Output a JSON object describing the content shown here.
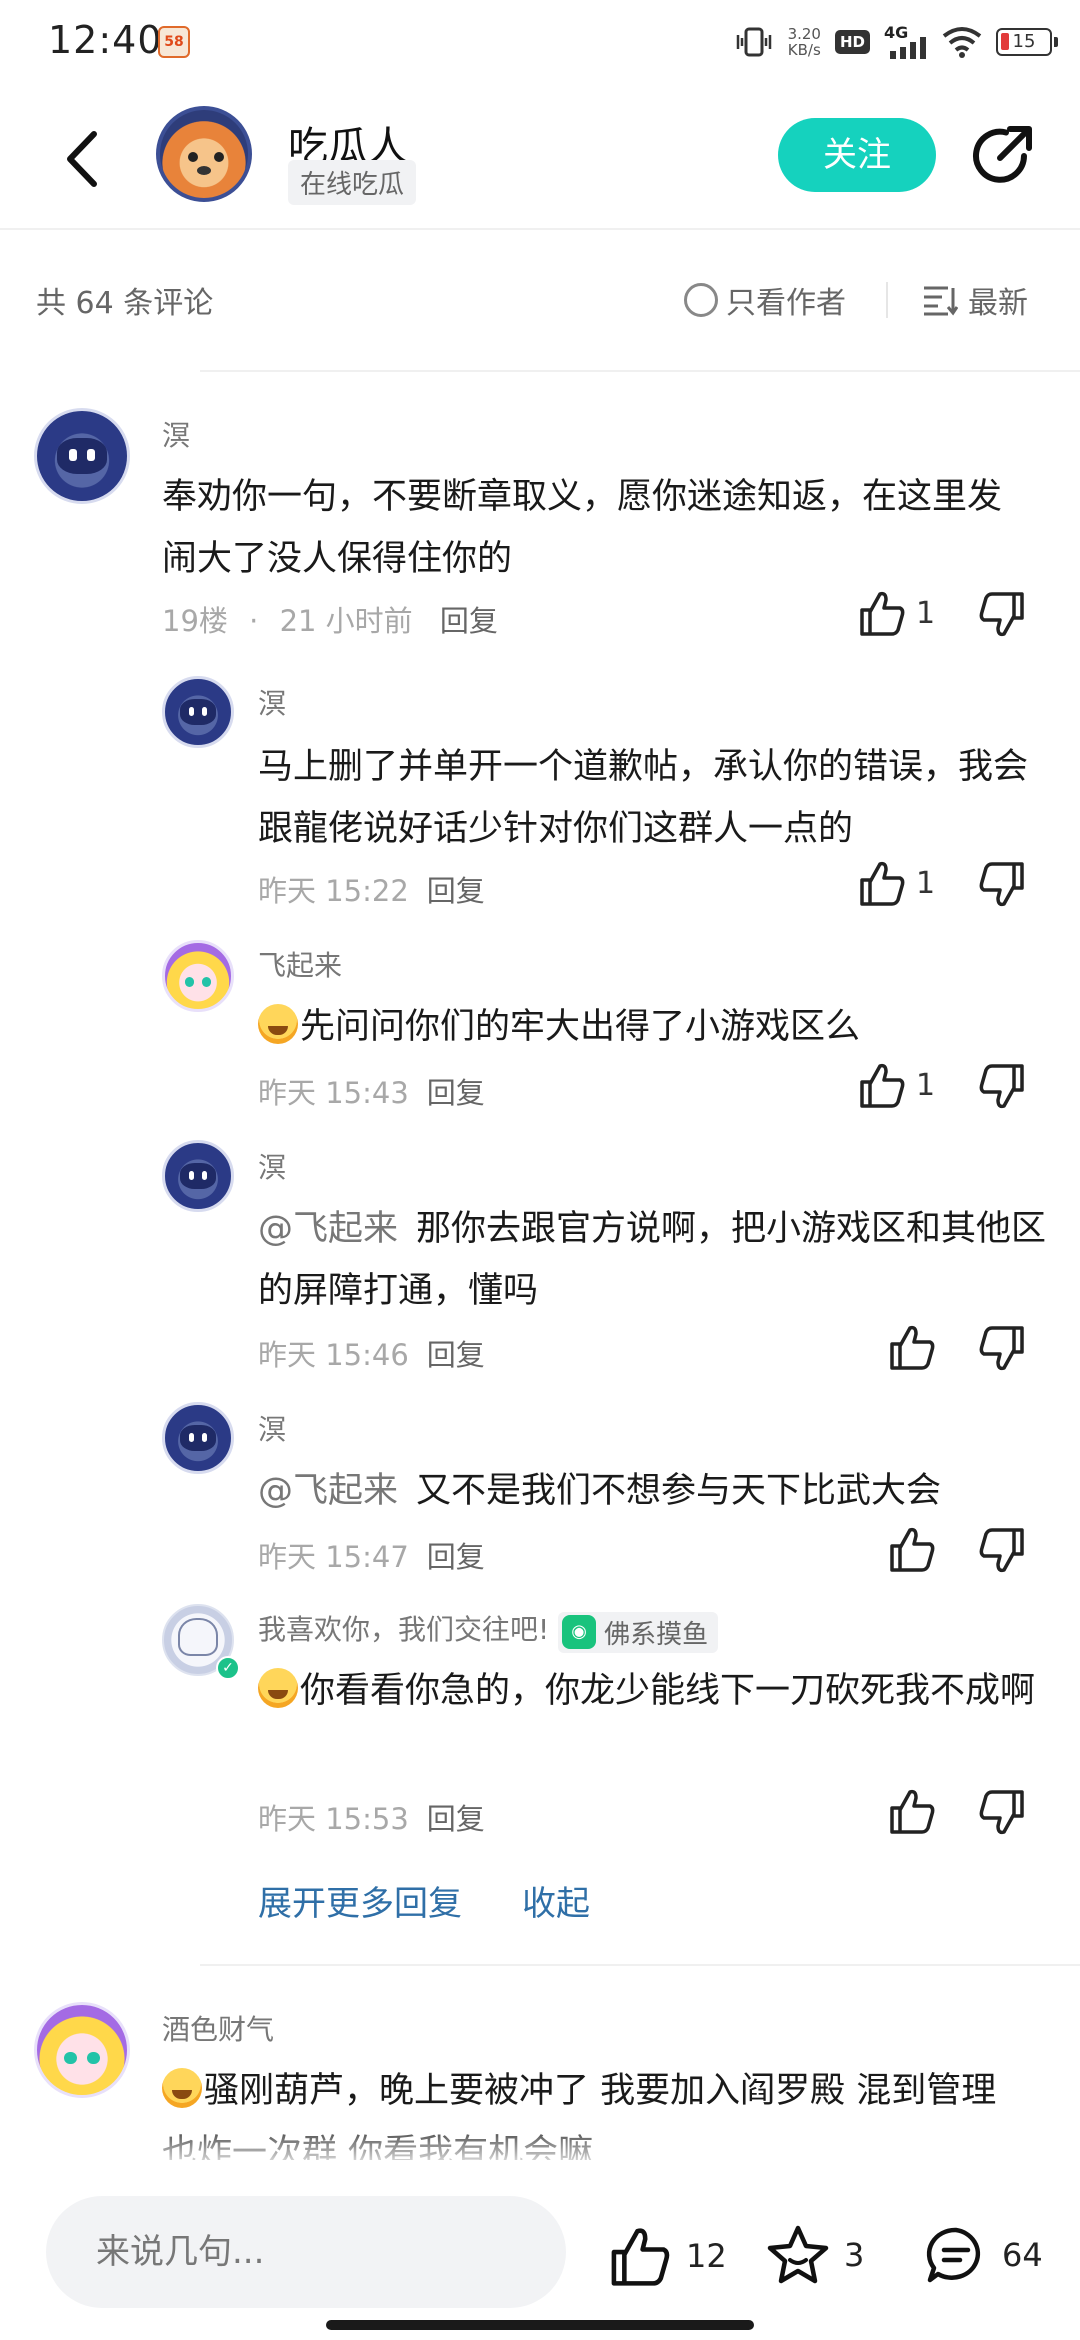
{
  "status_bar": {
    "time": "12:40",
    "app_badge": "58",
    "net_speed_value": "3.20",
    "net_speed_unit": "KB/s",
    "hd": "HD",
    "signal": "4G",
    "battery": "15"
  },
  "header": {
    "title": "吃瓜人",
    "subtitle": "在线吃瓜",
    "follow_label": "关注"
  },
  "comments_bar": {
    "count_label": "共 64 条评论",
    "author_only_label": "只看作者",
    "sort_label": "最新"
  },
  "comments": {
    "c1": {
      "user": "溟",
      "text": "奉劝你一句，不要断章取义，愿你迷途知返，在这里发闹大了没人保得住你的",
      "floor": "19楼",
      "dot": "·",
      "time": "21 小时前",
      "reply": "回复",
      "likes": "1"
    },
    "replies": [
      {
        "user": "溟",
        "text": "马上删了并单开一个道歉帖，承认你的错误，我会跟龍佬说好话少针对你们这群人一点的",
        "time": "昨天 15:22",
        "reply": "回复",
        "likes": "1"
      },
      {
        "user": "飞起来",
        "text": "先问问你们的牢大出得了小游戏区么",
        "time": "昨天 15:43",
        "reply": "回复",
        "likes": "1"
      },
      {
        "user": "溟",
        "mention": "@飞起来",
        "text": "那你去跟官方说啊，把小游戏区和其他区的屏障打通，懂吗",
        "time": "昨天 15:46",
        "reply": "回复",
        "likes": ""
      },
      {
        "user": "溟",
        "mention": "@飞起来",
        "text": "又不是我们不想参与天下比武大会",
        "time": "昨天 15:47",
        "reply": "回复",
        "likes": ""
      },
      {
        "user": "我喜欢你，我们交往吧!",
        "tag": "佛系摸鱼",
        "text": "你看看你急的，你龙少能线下一刀砍死我不成啊",
        "time": "昨天 15:53",
        "reply": "回复",
        "likes": ""
      }
    ],
    "expand_more": "展开更多回复",
    "collapse": "收起",
    "c2": {
      "user": "酒色财气",
      "text": "骚刚葫芦，晚上要被冲了   我要加入阎罗殿 混到管理也炸一次群  你看我有机会嘛"
    }
  },
  "bottom_bar": {
    "input_placeholder": "来说几句...",
    "like_count": "12",
    "fav_count": "3",
    "comment_count": "64"
  },
  "colors": {
    "accent": "#15d2be",
    "link": "#2f6fa7",
    "muted": "#a8a8a8"
  },
  "icons": [
    "back-arrow-icon",
    "share-icon",
    "radio-icon",
    "sort-icon",
    "thumb-up-icon",
    "thumb-down-icon",
    "star-icon",
    "comment-icon",
    "game-tag-icon",
    "laugh-emoji-icon"
  ]
}
